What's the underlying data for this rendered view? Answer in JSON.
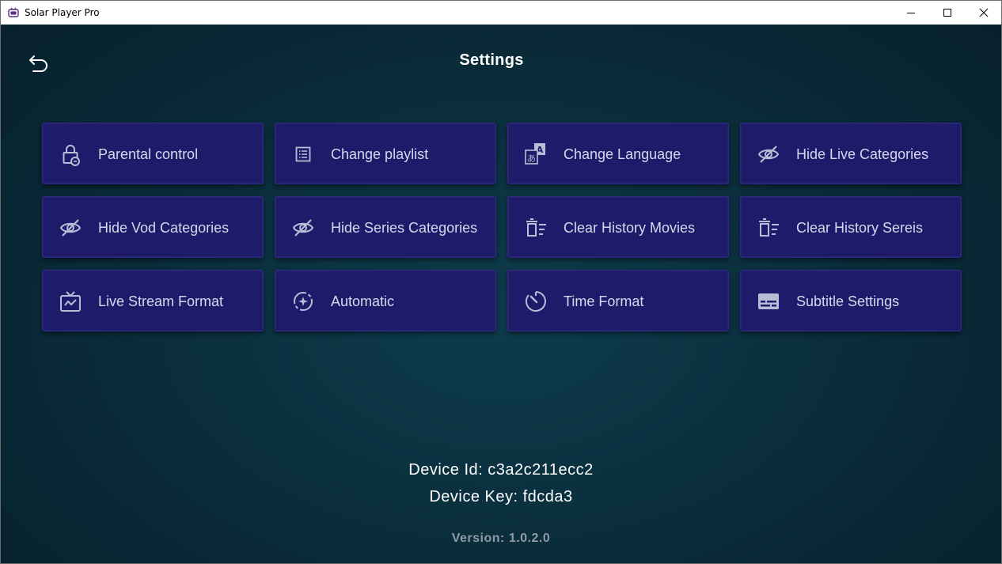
{
  "window": {
    "title": "Solar Player Pro",
    "minimize_icon": "minimize-icon",
    "maximize_icon": "maximize-icon",
    "close_icon": "close-icon"
  },
  "header": {
    "back_icon": "back-arrow-icon",
    "title": "Settings"
  },
  "settings": {
    "tiles": [
      {
        "label": "Parental control",
        "icon": "lock-icon"
      },
      {
        "label": "Change playlist",
        "icon": "list-icon"
      },
      {
        "label": "Change Language",
        "icon": "translate-icon"
      },
      {
        "label": "Hide Live Categories",
        "icon": "eye-off-icon"
      },
      {
        "label": "Hide Vod Categories",
        "icon": "eye-off-icon"
      },
      {
        "label": "Hide Series Categories",
        "icon": "eye-off-icon"
      },
      {
        "label": "Clear History Movies",
        "icon": "clear-history-icon"
      },
      {
        "label": "Clear History Sereis",
        "icon": "clear-history-icon"
      },
      {
        "label": "Live Stream Format",
        "icon": "live-tv-icon"
      },
      {
        "label": "Automatic",
        "icon": "auto-icon"
      },
      {
        "label": "Time Format",
        "icon": "timer-icon"
      },
      {
        "label": "Subtitle Settings",
        "icon": "subtitles-icon"
      }
    ]
  },
  "footer": {
    "device_id": "Device Id: c3a2c211ecc2",
    "device_key": "Device Key: fdcda3",
    "version": "Version: 1.0.2.0"
  },
  "colors": {
    "tile_bg": "#1f1b6b",
    "background": "#0a2c3a",
    "text": "#d6d8ec"
  }
}
